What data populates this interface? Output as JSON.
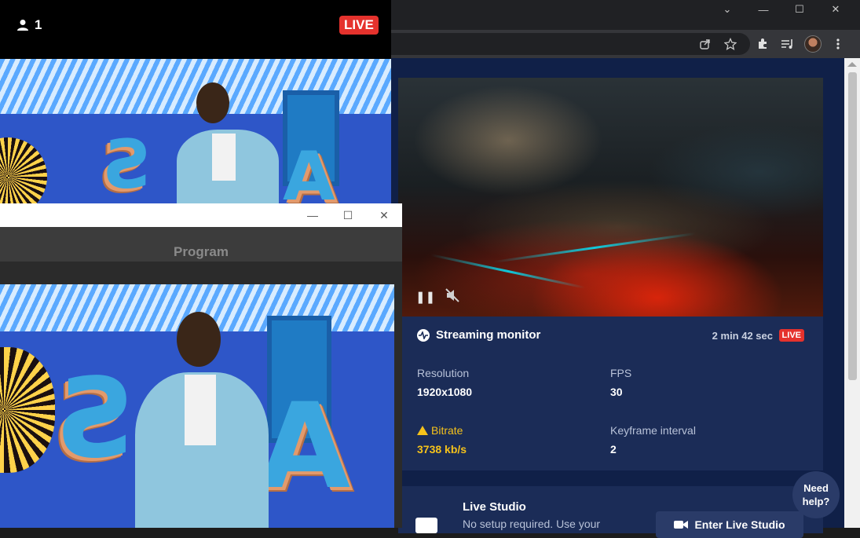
{
  "preview": {
    "viewer_count": "1",
    "live_badge": "LIVE"
  },
  "program_window": {
    "title": "Program",
    "controls": {
      "minimize": "—",
      "maximize": "☐",
      "close": "✕"
    }
  },
  "browser": {
    "window_controls": {
      "dropdown": "⌄",
      "minimize": "—",
      "maximize": "☐",
      "close": "✕"
    },
    "toolbar_icons": [
      "share-icon",
      "star-icon",
      "extensions-icon",
      "media-icon",
      "profile-avatar",
      "menu-icon"
    ]
  },
  "monitor": {
    "title": "Streaming monitor",
    "duration": "2 min 42 sec",
    "live_badge": "LIVE",
    "stats": {
      "resolution_label": "Resolution",
      "resolution_value": "1920x1080",
      "fps_label": "FPS",
      "fps_value": "30",
      "bitrate_label": "Bitrate",
      "bitrate_value": "3738 kb/s",
      "keyframe_label": "Keyframe interval",
      "keyframe_value": "2"
    }
  },
  "studio": {
    "title": "Live Studio",
    "description": "No setup required. Use your",
    "button": "Enter Live Studio"
  },
  "help": {
    "line1": "Need",
    "line2": "help?"
  },
  "colors": {
    "page_bg": "#102048",
    "card_bg": "#1b2c57",
    "live_red": "#e5322d",
    "warning_yellow": "#f5c21b"
  }
}
